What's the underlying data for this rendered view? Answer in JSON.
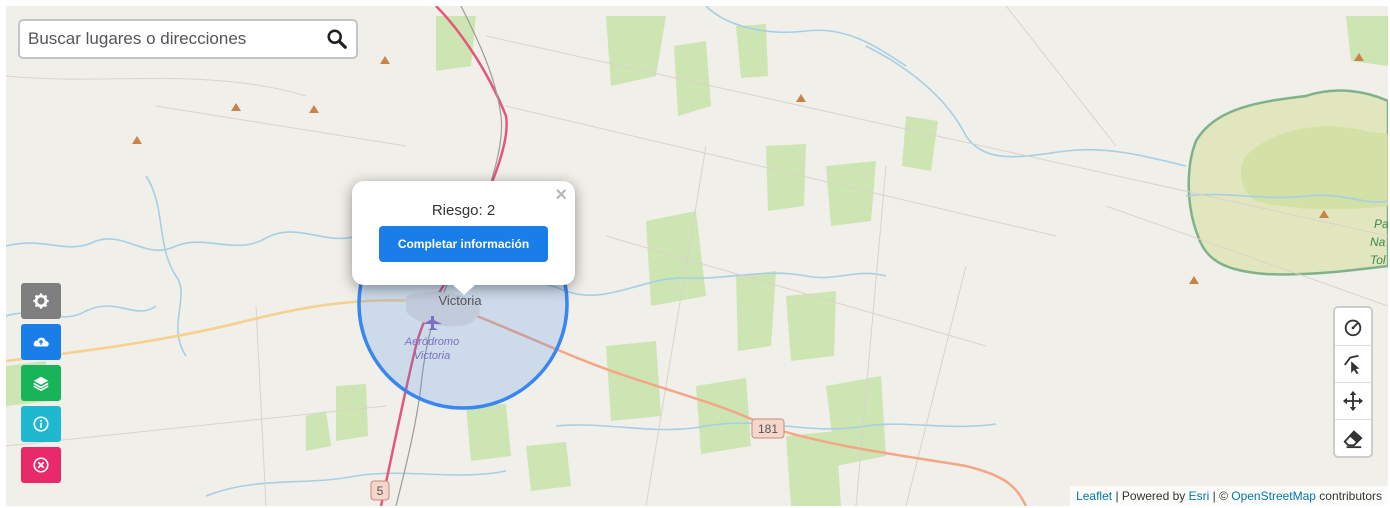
{
  "search": {
    "placeholder": "Buscar lugares o direcciones"
  },
  "left_buttons": [
    {
      "name": "settings-button",
      "icon": "gear-icon",
      "color": "#7f7f7f"
    },
    {
      "name": "upload-button",
      "icon": "cloud-upload-icon",
      "color": "#1a7ee8"
    },
    {
      "name": "layers-button",
      "icon": "layers-icon",
      "color": "#17b45a"
    },
    {
      "name": "info-button",
      "icon": "info-icon",
      "color": "#1fb8d0"
    },
    {
      "name": "close-button",
      "icon": "close-circle-icon",
      "color": "#e8296a"
    }
  ],
  "popup": {
    "title": "Riesgo: 2",
    "button_label": "Completar información",
    "close_symbol": "×"
  },
  "map_labels": {
    "town": "Victoria",
    "airport_line1": "Aeródromo",
    "airport_line2": "Victoria",
    "road_181": "181",
    "road_5": "5",
    "park_1": "Pa",
    "park_2": "Na",
    "park_3": "Tol"
  },
  "toolbar": [
    {
      "name": "draw-circle-button",
      "icon": "circle-draw-icon"
    },
    {
      "name": "draw-polyline-button",
      "icon": "polyline-draw-icon"
    },
    {
      "name": "move-button",
      "icon": "move-icon"
    },
    {
      "name": "erase-button",
      "icon": "eraser-icon"
    }
  ],
  "attribution": {
    "leaflet": "Leaflet",
    "sep1": " | Powered by ",
    "esri": "Esri",
    "sep2": " | © ",
    "osm": "OpenStreetMap",
    "suffix": " contributors"
  },
  "colors": {
    "land": "#f1efe9",
    "green_area": "#cde5b2",
    "park_fill": "#e1e6bf",
    "park_border": "#7fb28a",
    "river": "#a6cfe5",
    "primary_road": "#e5577a",
    "secondary_road": "#f4a687",
    "tertiary_road": "#f6d08c",
    "risk_circle": "#3a86f0"
  }
}
